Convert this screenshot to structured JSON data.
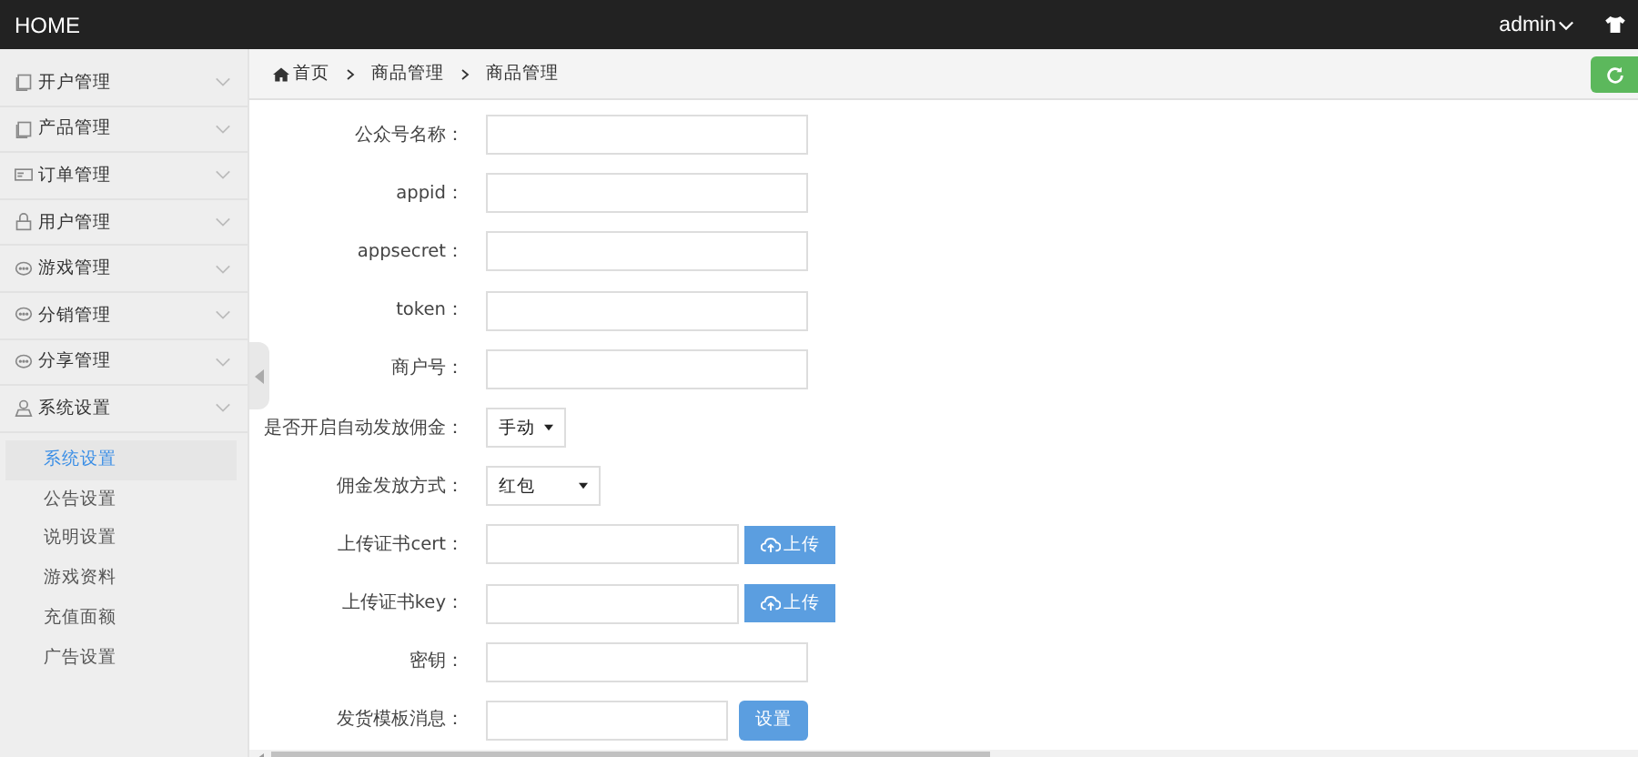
{
  "header": {
    "title": "HOME",
    "user": "admin"
  },
  "sidebar": {
    "items": [
      {
        "label": "开户管理"
      },
      {
        "label": "产品管理"
      },
      {
        "label": "订单管理"
      },
      {
        "label": "用户管理"
      },
      {
        "label": "游戏管理"
      },
      {
        "label": "分销管理"
      },
      {
        "label": "分享管理"
      },
      {
        "label": "系统设置",
        "children": [
          {
            "label": "系统设置",
            "selected": true
          },
          {
            "label": "公告设置",
            "selected": false
          },
          {
            "label": "说明设置",
            "selected": false
          },
          {
            "label": "游戏资料",
            "selected": false
          },
          {
            "label": "充值面额",
            "selected": false
          },
          {
            "label": "广告设置",
            "selected": false
          }
        ]
      }
    ]
  },
  "breadcrumb": [
    "首页",
    "商品管理",
    "商品管理"
  ],
  "form": [
    {
      "kind": "input",
      "label": "公众号名称："
    },
    {
      "kind": "input",
      "label": "appid："
    },
    {
      "kind": "input",
      "label": "appsecret："
    },
    {
      "kind": "input",
      "label": "token："
    },
    {
      "kind": "input",
      "label": "商户号："
    },
    {
      "kind": "select",
      "label": "是否开启自动发放佣金：",
      "value": "手动"
    },
    {
      "kind": "select",
      "label": "佣金发放方式：",
      "value": "红包"
    },
    {
      "kind": "upload",
      "label": "上传证书cert：",
      "button": "上传"
    },
    {
      "kind": "upload",
      "label": "上传证书key：",
      "button": "上传"
    },
    {
      "kind": "input",
      "label": "密钥："
    },
    {
      "kind": "action",
      "label": "发货模板消息：",
      "button": "设置"
    }
  ]
}
